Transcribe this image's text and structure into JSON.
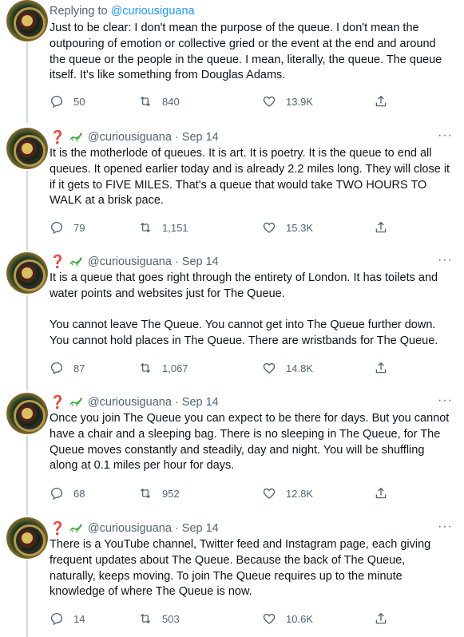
{
  "reply_context": {
    "prefix": "Replying to",
    "handle": "@curiousiguana"
  },
  "tweets": [
    {
      "show_header": false,
      "text": "Just to be clear: I don't mean the purpose of the queue. I don't mean the outpouring of emotion or collective gried or the event at the end and around the queue or the people in the queue. I mean, literally, the queue. The queue itself. It's like something from Douglas Adams.",
      "replies": "50",
      "retweets": "840",
      "likes": "13.9K"
    },
    {
      "show_header": true,
      "handle": "@curiousiguana",
      "separator": "·",
      "date": "Sep 14",
      "text": "It is the motherlode of queues. It is art. It is poetry. It is the queue to end all queues. It opened earlier today and is already 2.2 miles long. They will close it if it gets to FIVE MILES. That's a queue that would take TWO HOURS TO WALK at a brisk pace.",
      "replies": "79",
      "retweets": "1,151",
      "likes": "15.3K"
    },
    {
      "show_header": true,
      "handle": "@curiousiguana",
      "separator": "·",
      "date": "Sep 14",
      "text": "It is a queue that goes right through the entirety of London. It has toilets and water points and websites just for The Queue.\n\nYou cannot leave The Queue. You cannot get into The Queue further down. You cannot hold places in The Queue. There are wristbands for The Queue.",
      "replies": "87",
      "retweets": "1,067",
      "likes": "14.8K"
    },
    {
      "show_header": true,
      "handle": "@curiousiguana",
      "separator": "·",
      "date": "Sep 14",
      "text": "Once you join The Queue you can expect to be there for days. But you cannot have a chair and a sleeping bag. There is no sleeping in The Queue, for The Queue moves constantly and steadily, day and night. You will be shuffling along at 0.1 miles per hour for days.",
      "replies": "68",
      "retweets": "952",
      "likes": "12.8K"
    },
    {
      "show_header": true,
      "handle": "@curiousiguana",
      "separator": "·",
      "date": "Sep 14",
      "text": "There is a YouTube channel, Twitter feed and Instagram page, each giving frequent updates about The Queue. Because the back of The Queue, naturally, keeps moving. To join The Queue requires up to the minute knowledge of where The Queue is now.",
      "replies": "14",
      "retweets": "503",
      "likes": "10.6K"
    }
  ],
  "display_name_emoji": "❓",
  "more_label": "···",
  "colors": {
    "text": "#0f1419",
    "secondary": "#536471",
    "link": "#1d9bf0",
    "thread_line": "#cfd9de"
  }
}
